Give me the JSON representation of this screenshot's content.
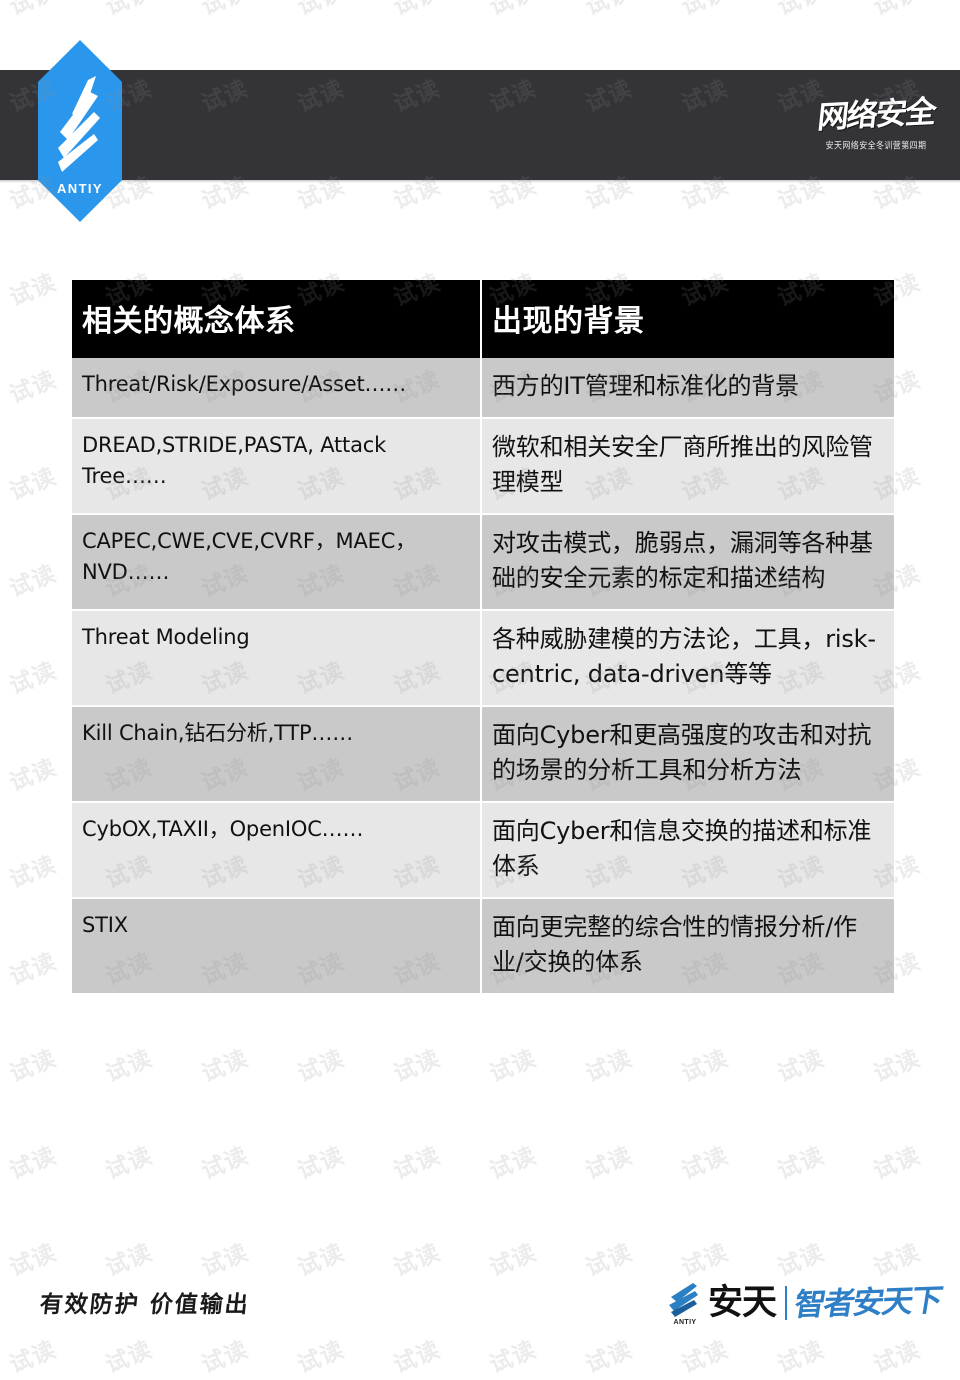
{
  "slide": {
    "background_color": "#ffffff",
    "header_band_color": "#333338",
    "accent_color": "#2b97ec"
  },
  "header": {
    "logo": {
      "icon": "antiy-feather-hexagon-logo",
      "wordmark": "ANTIY",
      "color": "#2b97ec"
    },
    "emblem": {
      "icon": "calligraphy-emblem",
      "main_text": "网络安全",
      "sub_text": "安天网络安全冬训营第四期"
    }
  },
  "table": {
    "columns": [
      {
        "key": "concept",
        "header": "相关的概念体系"
      },
      {
        "key": "context",
        "header": "出现的背景"
      }
    ],
    "header_background": "#000000",
    "header_text_color": "#ffffff",
    "row_shade_dark": "#c9c9c9",
    "row_shade_light": "#e7e7e7",
    "rows": [
      {
        "shade": "dark",
        "concept": "Threat/Risk/Exposure/Asset……",
        "context": "西方的IT管理和标准化的背景"
      },
      {
        "shade": "light",
        "concept": "DREAD,STRIDE,PASTA, Attack Tree……",
        "context": "微软和相关安全厂商所推出的风险管理模型"
      },
      {
        "shade": "dark",
        "concept": "CAPEC,CWE,CVE,CVRF，MAEC，NVD……",
        "context": "对攻击模式，脆弱点，漏洞等各种基础的安全元素的标定和描述结构"
      },
      {
        "shade": "light",
        "concept": "Threat Modeling",
        "context": "各种威胁建模的方法论，工具，risk-centric, data-driven等等"
      },
      {
        "shade": "dark",
        "concept": "Kill Chain,钻石分析,TTP……",
        "context": "面向Cyber和更高强度的攻击和对抗的场景的分析工具和分析方法"
      },
      {
        "shade": "light",
        "concept": "CybOX,TAXII，OpenIOC……",
        "context": "面向Cyber和信息交换的描述和标准体系"
      },
      {
        "shade": "dark",
        "concept": "STIX",
        "context": "面向更完整的综合性的情报分析/作业/交换的体系"
      }
    ]
  },
  "footer": {
    "slogan": "有效防护 价值输出",
    "brand": {
      "icon": "antiy-feather-logo",
      "wordmark": "ANTIY",
      "name": "安天",
      "tagline": "智者安天下",
      "tagline_color": "#2f7fc6"
    }
  },
  "watermark": {
    "text": "试读",
    "color": "rgba(140,140,140,0.17)",
    "angle_deg": -22
  }
}
